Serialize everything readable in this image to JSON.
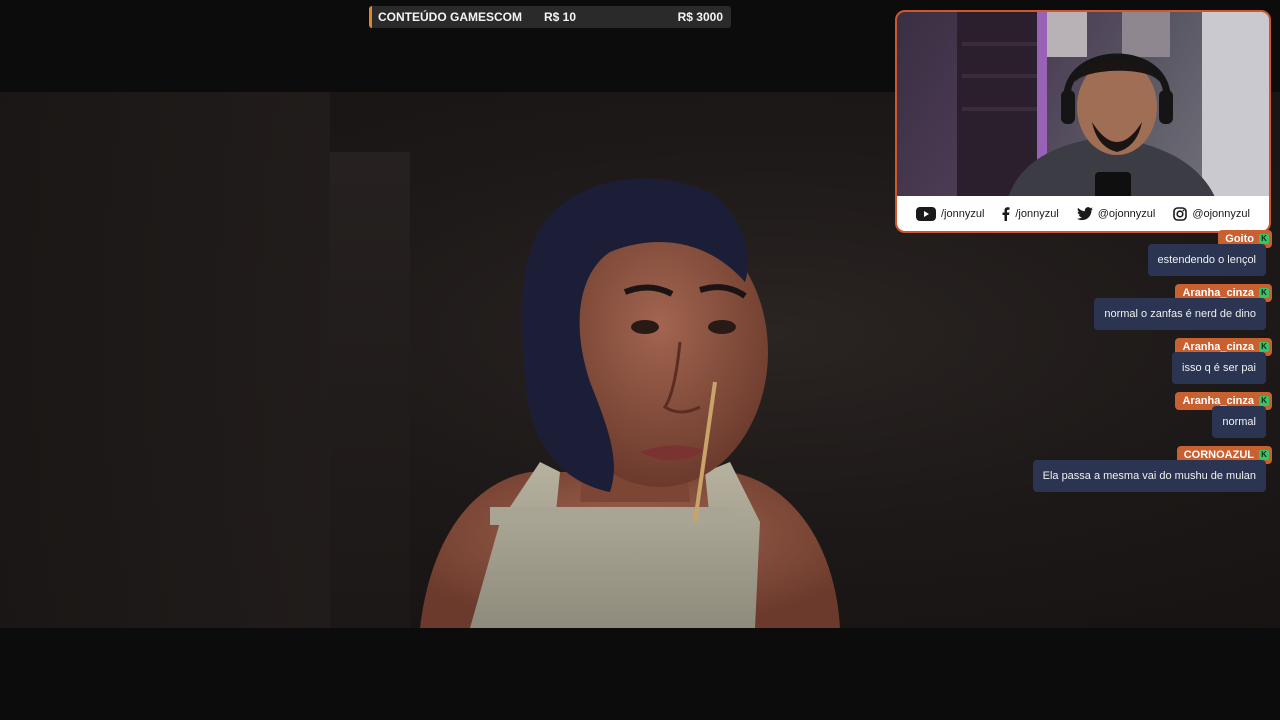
{
  "goal": {
    "title": "CONTEÚDO GAMESCOM",
    "current": "R$ 10",
    "target": "R$ 3000",
    "accent": "#e0862e"
  },
  "webcam": {
    "border_color": "#d2562c",
    "socials": [
      {
        "icon": "youtube-icon",
        "handle": "/jonnyzul"
      },
      {
        "icon": "facebook-icon",
        "handle": "/jonnyzul"
      },
      {
        "icon": "twitter-icon",
        "handle": "@ojonnyzul"
      },
      {
        "icon": "instagram-icon",
        "handle": "@ojonnyzul"
      }
    ]
  },
  "chat": {
    "name_color": "#c9602f",
    "bubble_color": "#2b3552",
    "messages": [
      {
        "user": "Goito",
        "text": "estendendo o lençol"
      },
      {
        "user": "Aranha_cinza",
        "text": "normal o zanfas é nerd de dino"
      },
      {
        "user": "Aranha_cinza",
        "text": "isso q é ser pai"
      },
      {
        "user": "Aranha_cinza",
        "text": "normal"
      },
      {
        "user": "CORNOAZUL",
        "text": "Ela passa a mesma vai do mushu de mulan"
      }
    ]
  }
}
